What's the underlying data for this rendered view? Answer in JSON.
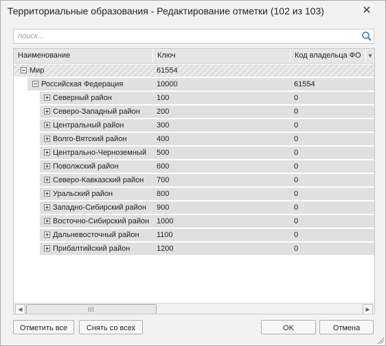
{
  "window": {
    "title": "Территориальные образования - Редактирование отметки (102 из 103)"
  },
  "search": {
    "placeholder": "поиск..."
  },
  "columns": [
    "Наименование",
    "Ключ",
    "Код владельца ФО"
  ],
  "rows": [
    {
      "name": "Мир",
      "key": "61554",
      "owner": "",
      "level": 0,
      "state": "expanded"
    },
    {
      "name": "Российская Федерация",
      "key": "10000",
      "owner": "61554",
      "level": 1,
      "state": "expanded"
    },
    {
      "name": "Северный район",
      "key": "100",
      "owner": "0",
      "level": 2,
      "state": "collapsed"
    },
    {
      "name": "Северо-Западный район",
      "key": "200",
      "owner": "0",
      "level": 2,
      "state": "collapsed"
    },
    {
      "name": "Центральный район",
      "key": "300",
      "owner": "0",
      "level": 2,
      "state": "collapsed"
    },
    {
      "name": "Волго-Вятский район",
      "key": "400",
      "owner": "0",
      "level": 2,
      "state": "collapsed"
    },
    {
      "name": "Центрально-Черноземный",
      "key": "500",
      "owner": "0",
      "level": 2,
      "state": "collapsed"
    },
    {
      "name": "Поволжский район",
      "key": "600",
      "owner": "0",
      "level": 2,
      "state": "collapsed"
    },
    {
      "name": "Северо-Кавказский район",
      "key": "700",
      "owner": "0",
      "level": 2,
      "state": "collapsed"
    },
    {
      "name": "Уральский район",
      "key": "800",
      "owner": "0",
      "level": 2,
      "state": "collapsed"
    },
    {
      "name": "Западно-Сибирский район",
      "key": "900",
      "owner": "0",
      "level": 2,
      "state": "collapsed"
    },
    {
      "name": "Восточно-Сибирский район",
      "key": "1000",
      "owner": "0",
      "level": 2,
      "state": "collapsed"
    },
    {
      "name": "Дальневосточный район",
      "key": "1100",
      "owner": "0",
      "level": 2,
      "state": "collapsed"
    },
    {
      "name": "Прибалтийский район",
      "key": "1200",
      "owner": "0",
      "level": 2,
      "state": "collapsed"
    }
  ],
  "buttons": {
    "select_all": "Отметить все",
    "deselect_all": "Снять со всех",
    "ok": "OK",
    "cancel": "Отмена"
  },
  "icons": {
    "close": "close-icon",
    "search": "search-icon",
    "column_menu": "chevron-down-icon",
    "scroll_left": "arrow-left-icon",
    "scroll_right": "arrow-right-icon"
  },
  "colors": {
    "selected_row": "#e0e0e0",
    "header_bg": "#e6e6e6",
    "dialog_bg": "#f2f2f2"
  }
}
